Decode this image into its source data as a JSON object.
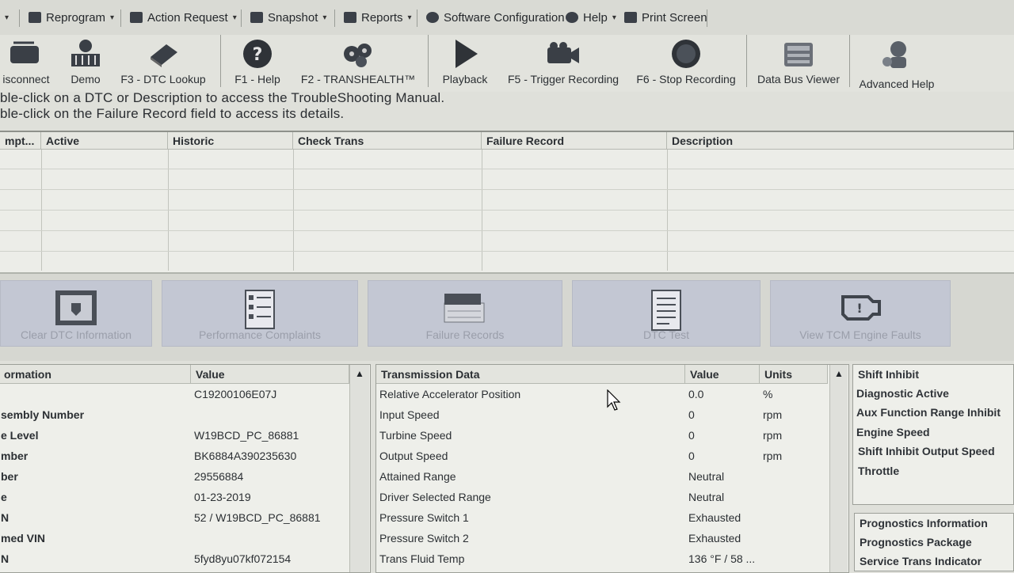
{
  "menubar": {
    "items": [
      {
        "label": "Reprogram",
        "icon": "reprogram-icon"
      },
      {
        "label": "Action Request",
        "icon": "action-request-icon"
      },
      {
        "label": "Snapshot",
        "icon": "snapshot-icon"
      },
      {
        "label": "Reports",
        "icon": "reports-icon"
      },
      {
        "label": "Software Configuration",
        "icon": "software-config-icon"
      },
      {
        "label": "Help",
        "icon": "help-icon"
      },
      {
        "label": "Print Screen",
        "icon": "print-screen-icon"
      }
    ]
  },
  "toolbar": {
    "items": [
      {
        "label": "isconnect",
        "icon": "disconnect-icon"
      },
      {
        "label": "Demo",
        "icon": "demo-icon"
      },
      {
        "label": "F3 - DTC Lookup",
        "icon": "book-icon"
      },
      {
        "label": "F1 - Help",
        "icon": "question-icon"
      },
      {
        "label": "F2 - TRANSHEALTH™",
        "icon": "transhealth-icon"
      },
      {
        "label": "Playback",
        "icon": "play-icon"
      },
      {
        "label": "F5 - Trigger Recording",
        "icon": "camera-icon"
      },
      {
        "label": "F6 - Stop Recording",
        "icon": "stop-icon"
      },
      {
        "label": "Data Bus Viewer",
        "icon": "data-bus-icon"
      },
      {
        "label": "Advanced Help",
        "icon": "advanced-help-icon"
      }
    ]
  },
  "instructions": {
    "line1": "ble-click on a DTC or Description to access the TroubleShooting Manual.",
    "line2": "ble-click on the Failure Record field to access its details."
  },
  "dtc_table": {
    "columns": [
      "mpt...",
      "Active",
      "Historic",
      "Check Trans",
      "Failure Record",
      "Description"
    ]
  },
  "action_buttons": [
    {
      "label": "Clear DTC Information",
      "icon": "clear-dtc-icon"
    },
    {
      "label": "Performance Complaints",
      "icon": "checklist-icon"
    },
    {
      "label": "Failure Records",
      "icon": "failure-records-icon"
    },
    {
      "label": "DTC Test",
      "icon": "dtc-test-icon"
    },
    {
      "label": "View TCM Engine Faults",
      "icon": "engine-icon"
    }
  ],
  "info_panel": {
    "col1": "ormation",
    "col2": "Value",
    "rows": [
      {
        "name": "",
        "value": "C19200106E07J"
      },
      {
        "name": "sembly Number",
        "value": ""
      },
      {
        "name": "e Level",
        "value": "W19BCD_PC_86881"
      },
      {
        "name": "mber",
        "value": "BK6884A390235630"
      },
      {
        "name": "ber",
        "value": "29556884"
      },
      {
        "name": "e",
        "value": "01-23-2019"
      },
      {
        "name": "N",
        "value": "52 / W19BCD_PC_86881"
      },
      {
        "name": "med VIN",
        "value": ""
      },
      {
        "name": "N",
        "value": "5fyd8yu07kf072154"
      }
    ]
  },
  "trans_panel": {
    "col1": "Transmission Data",
    "col2": "Value",
    "col3": "Units",
    "rows": [
      {
        "name": "Relative Accelerator Position",
        "value": "0.0",
        "unit": "%"
      },
      {
        "name": "Input Speed",
        "value": "0",
        "unit": "rpm"
      },
      {
        "name": "Turbine Speed",
        "value": "0",
        "unit": "rpm"
      },
      {
        "name": "Output Speed",
        "value": "0",
        "unit": "rpm"
      },
      {
        "name": "Attained Range",
        "value": "Neutral",
        "unit": ""
      },
      {
        "name": "Driver Selected Range",
        "value": "Neutral",
        "unit": ""
      },
      {
        "name": "Pressure Switch 1",
        "value": "Exhausted",
        "unit": ""
      },
      {
        "name": "Pressure Switch 2",
        "value": "Exhausted",
        "unit": ""
      },
      {
        "name": "Trans Fluid Temp",
        "value": "136 °F / 58 ...",
        "unit": ""
      }
    ]
  },
  "right_list_1": [
    "Shift Inhibit",
    "Diagnostic Active",
    "Aux Function Range Inhibit",
    "Engine Speed",
    "Shift Inhibit Output Speed",
    "Throttle"
  ],
  "right_list_2": [
    "Prognostics Information",
    "Prognostics Package",
    "Service Trans Indicator"
  ]
}
